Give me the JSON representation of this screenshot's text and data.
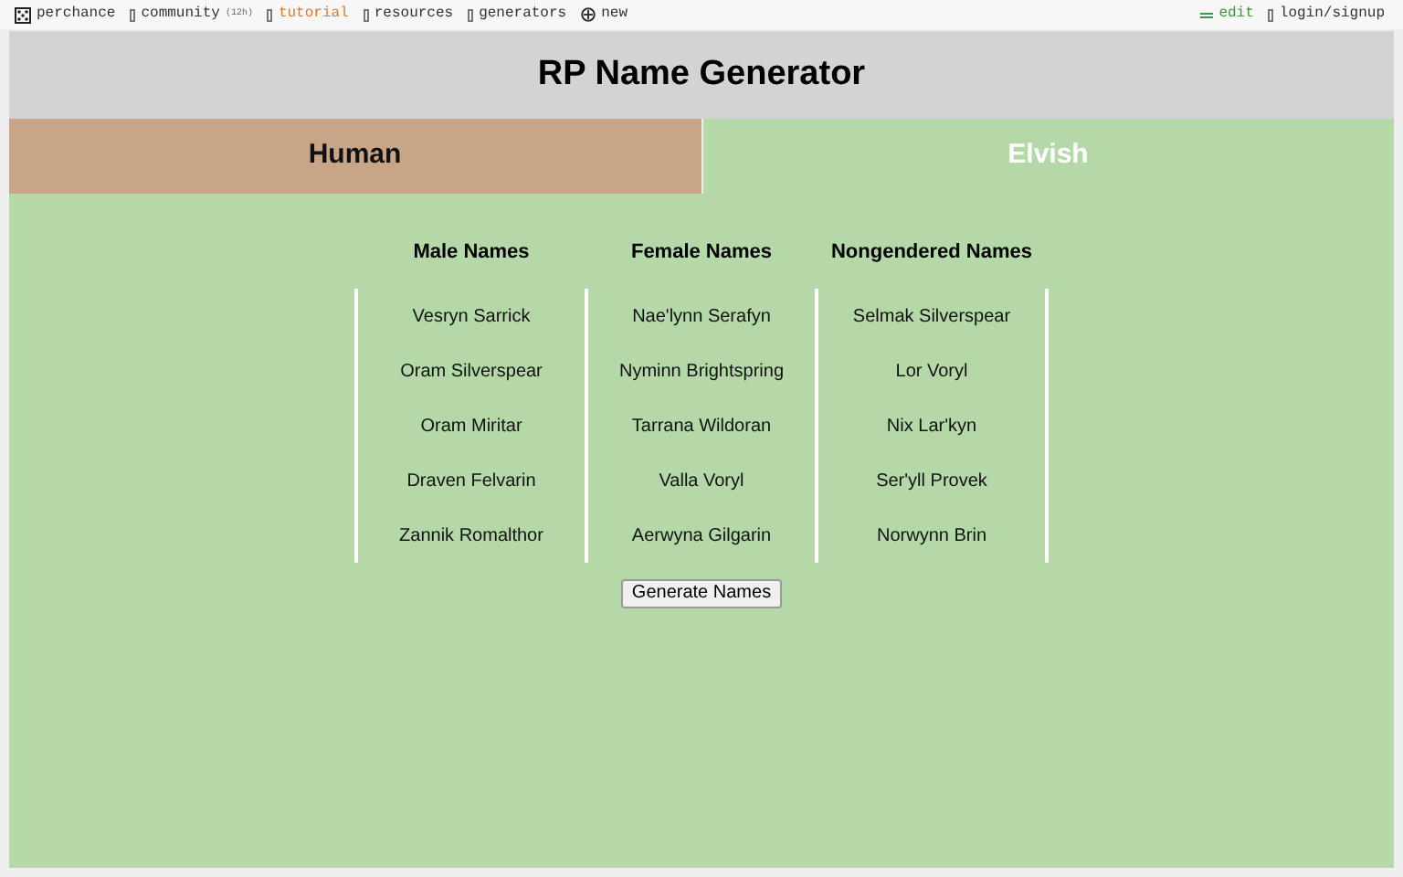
{
  "nav": {
    "items": [
      {
        "label": "perchance",
        "kind": "home",
        "selected": false
      },
      {
        "label": "community",
        "note": "(12h)",
        "kind": "link",
        "selected": false
      },
      {
        "label": "tutorial",
        "kind": "link",
        "selected": true
      },
      {
        "label": "resources",
        "kind": "link",
        "selected": false
      },
      {
        "label": "generators",
        "kind": "link",
        "selected": false
      },
      {
        "label": "new",
        "kind": "new",
        "selected": false
      }
    ],
    "right": [
      {
        "label": "edit",
        "kind": "edit"
      },
      {
        "label": "login/signup",
        "kind": "plain"
      }
    ]
  },
  "title": "RP Name Generator",
  "tabs": [
    {
      "label": "Human",
      "selected": false
    },
    {
      "label": "Elvish",
      "selected": true
    }
  ],
  "table": {
    "columns": [
      "Male Names",
      "Female Names",
      "Nongendered Names"
    ],
    "rows": [
      [
        "Vesryn Sarrick",
        "Nae'lynn Serafyn",
        "Selmak Silverspear"
      ],
      [
        "Oram Silverspear",
        "Nyminn Brightspring",
        "Lor Voryl"
      ],
      [
        "Oram Miritar",
        "Tarrana Wildoran",
        "Nix Lar'kyn"
      ],
      [
        "Draven Felvarin",
        "Valla Voryl",
        "Ser'yll Provek"
      ],
      [
        "Zannik Romalthor",
        "Aerwyna Gilgarin",
        "Norwynn Brin"
      ]
    ]
  },
  "button": "Generate Names"
}
